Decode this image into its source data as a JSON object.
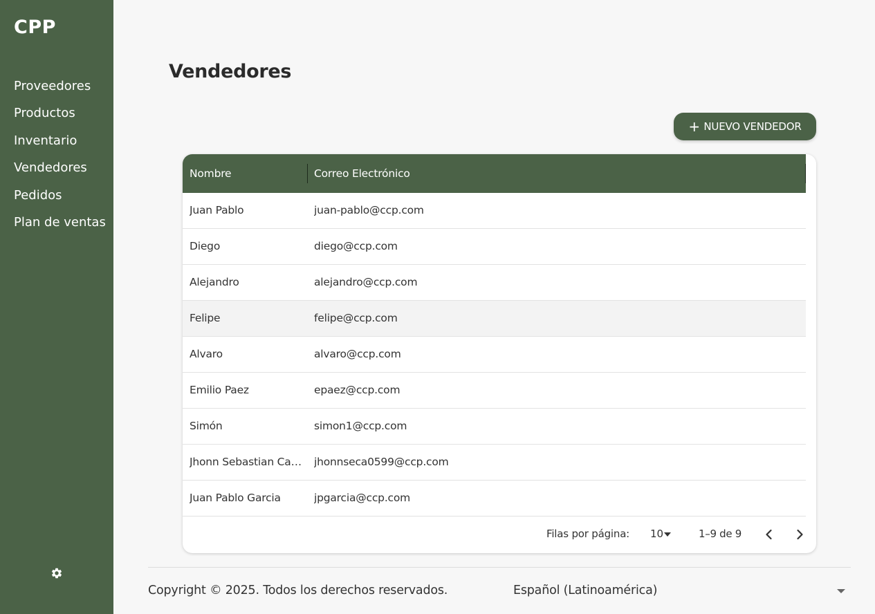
{
  "sidebar": {
    "brand": "CPP",
    "items": [
      {
        "label": "Proveedores"
      },
      {
        "label": "Productos"
      },
      {
        "label": "Inventario"
      },
      {
        "label": "Vendedores"
      },
      {
        "label": "Pedidos"
      },
      {
        "label": "Plan de ventas"
      }
    ],
    "settings_icon": "gear-icon"
  },
  "main": {
    "title": "Vendedores",
    "new_button": {
      "label": "NUEVO VENDEDOR",
      "icon": "plus-icon"
    }
  },
  "table": {
    "columns": [
      "Nombre",
      "Correo Electrónico"
    ],
    "rows": [
      {
        "name": "Juan Pablo",
        "email": "juan-pablo@ccp.com"
      },
      {
        "name": "Diego",
        "email": "diego@ccp.com"
      },
      {
        "name": "Alejandro",
        "email": "alejandro@ccp.com"
      },
      {
        "name": "Felipe",
        "email": "felipe@ccp.com"
      },
      {
        "name": "Alvaro",
        "email": "alvaro@ccp.com"
      },
      {
        "name": "Emilio Paez",
        "email": "epaez@ccp.com"
      },
      {
        "name": "Simón",
        "email": "simon1@ccp.com"
      },
      {
        "name": "Jhonn Sebastian Ca…",
        "email": "jhonnseca0599@ccp.com"
      },
      {
        "name": "Juan Pablo Garcia",
        "email": "jpgarcia@ccp.com"
      }
    ],
    "pagination": {
      "rows_per_page_label": "Filas por página:",
      "rows_per_page_value": "10",
      "range": "1–9 de 9"
    }
  },
  "footer": {
    "copyright": "Copyright © 2025. Todos los derechos reservados.",
    "language": "Español (Latinoamérica)"
  },
  "colors": {
    "accent": "#4b6247",
    "background": "#f7f7f7",
    "surface": "#ffffff"
  }
}
